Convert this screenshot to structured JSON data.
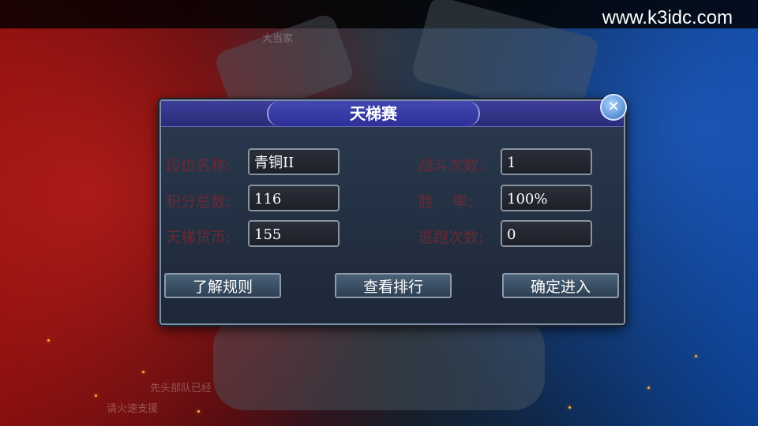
{
  "watermark": "www.k3idc.com",
  "background": {
    "name_text": "大当家",
    "chat_line_1": "先头部队已经",
    "chat_line_2": "请火速支援"
  },
  "dialog": {
    "title": "天梯赛",
    "close_icon": "✕",
    "fields_left": [
      {
        "label": "段位名称:",
        "value": "青铜II"
      },
      {
        "label": "积分总数:",
        "value": "116"
      },
      {
        "label": "天梯货币:",
        "value": "155"
      }
    ],
    "fields_right": [
      {
        "label": "战斗次数:",
        "value": "1"
      },
      {
        "label": "胜    率:",
        "value": "100%"
      },
      {
        "label": "逃跑次数:",
        "value": "0"
      }
    ],
    "buttons": {
      "rules": "了解规则",
      "ranking": "查看排行",
      "enter": "确定进入"
    }
  },
  "colors": {
    "label": "#6a2a34",
    "title_bar": "#2e309a",
    "panel": "#1d2838"
  }
}
